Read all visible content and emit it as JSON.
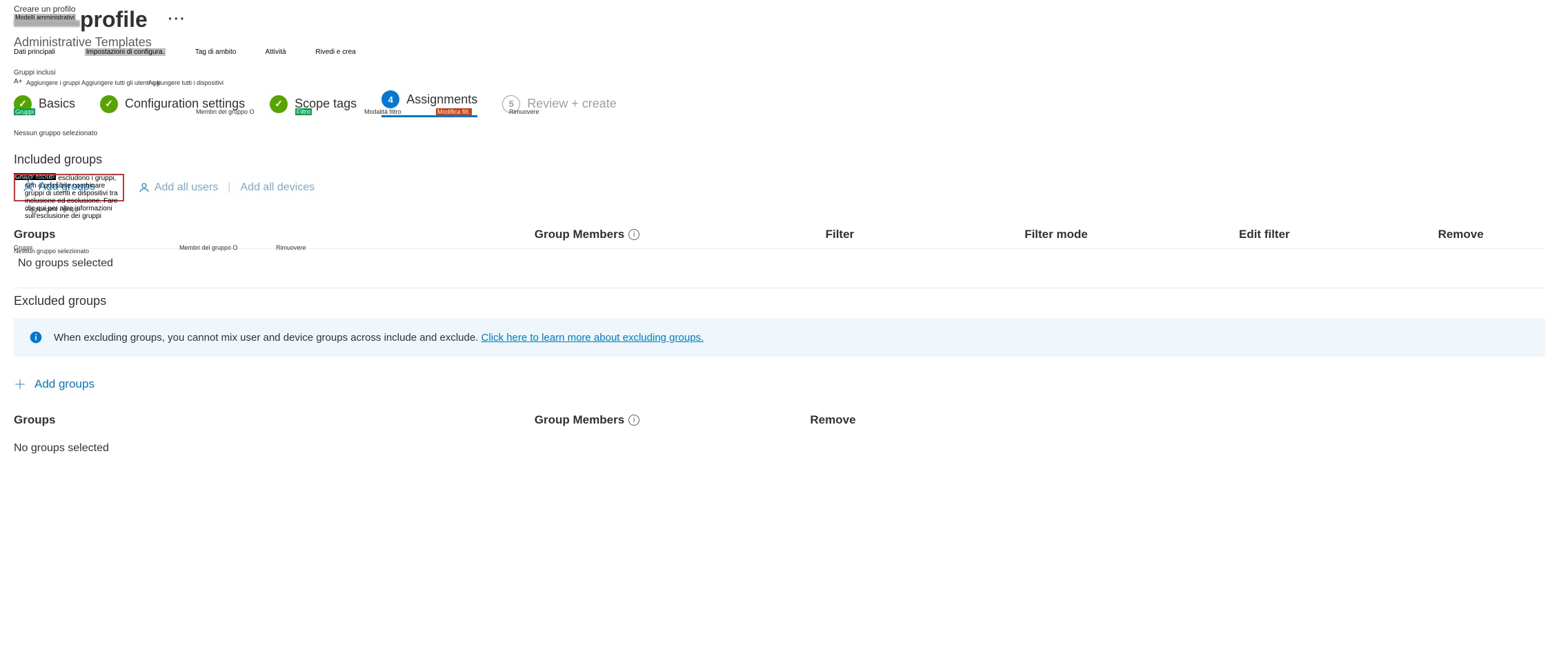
{
  "header": {
    "overlay_create_profile": "Creare un profilo",
    "overlay_admin_templates_badge": "Modelli amministrativi",
    "title_suffix": " profile",
    "subtitle": "Administrative Templates"
  },
  "overlay_tabs": {
    "dati_principali": "Dati principali",
    "impostazioni_badge": "Impostazioni di configura.",
    "tag_ambito": "Tag di ambito",
    "attivita": "Attività",
    "rivedi": "Rivedi e crea"
  },
  "gruppi_inclusi_label": "Gruppi inclusi",
  "a_plus": "A+",
  "overlay_agg_gruppi": "Aggiungere i gruppi",
  "overlay_agg_utenti": "Aggiungere tutti gli utenti = k",
  "overlay_agg_disp": "Aggiungere tutti i dispositivi",
  "wizard": {
    "basics": "Basics",
    "config": "Configuration settings",
    "scope": "Scope tags",
    "assignments": "Assignments",
    "review": "Review + create",
    "step4_num": "4",
    "step5_num": "5"
  },
  "overlay_gruppi_box": "Gruppi",
  "overlay_membri": "Membri del gruppo O",
  "overlay_filtro_box": "Filtro",
  "overlay_modalita": "Modalità filtro",
  "overlay_modifica_box": "Modifica filt.",
  "overlay_rimuovere": "Rimuovere",
  "nessun_gruppo": "Nessun gruppo selezionato",
  "included": {
    "heading": "Included groups",
    "esclusi_overlay": "Gruppi esclusi",
    "add_groups": "Add groups",
    "add_users": "Add all users",
    "add_devices": "Add all devices",
    "notice": "Quando si escludono i gruppi, non è possibile combinare gruppi di utenti e dispositivi tra inclusione ed esclusione. Fare clic qui per altre informazioni sull'esclusione dei gruppi",
    "table": {
      "groups": "Groups",
      "members": "Group Members",
      "filter": "Filter",
      "filter_mode": "Filter mode",
      "edit_filter": "Edit filter",
      "remove": "Remove",
      "overlay_agg_gruppi2": "Aggiungere i gruppi",
      "overlay_gruppi2": "Gruppi",
      "overlay_membri2": "Membri del gruppo O",
      "overlay_rim2": "Rimuovere"
    },
    "empty": "No groups selected",
    "overlay_nessun2": "Nessun gruppo selezionato"
  },
  "excluded": {
    "heading": "Excluded groups",
    "notice_text": "When excluding groups, you cannot mix user and device groups across include and exclude. ",
    "notice_link": "Click here to learn more about excluding groups.",
    "add_groups": "Add groups",
    "table": {
      "groups": "Groups",
      "members": "Group Members",
      "remove": "Remove"
    },
    "empty": "No groups selected"
  }
}
